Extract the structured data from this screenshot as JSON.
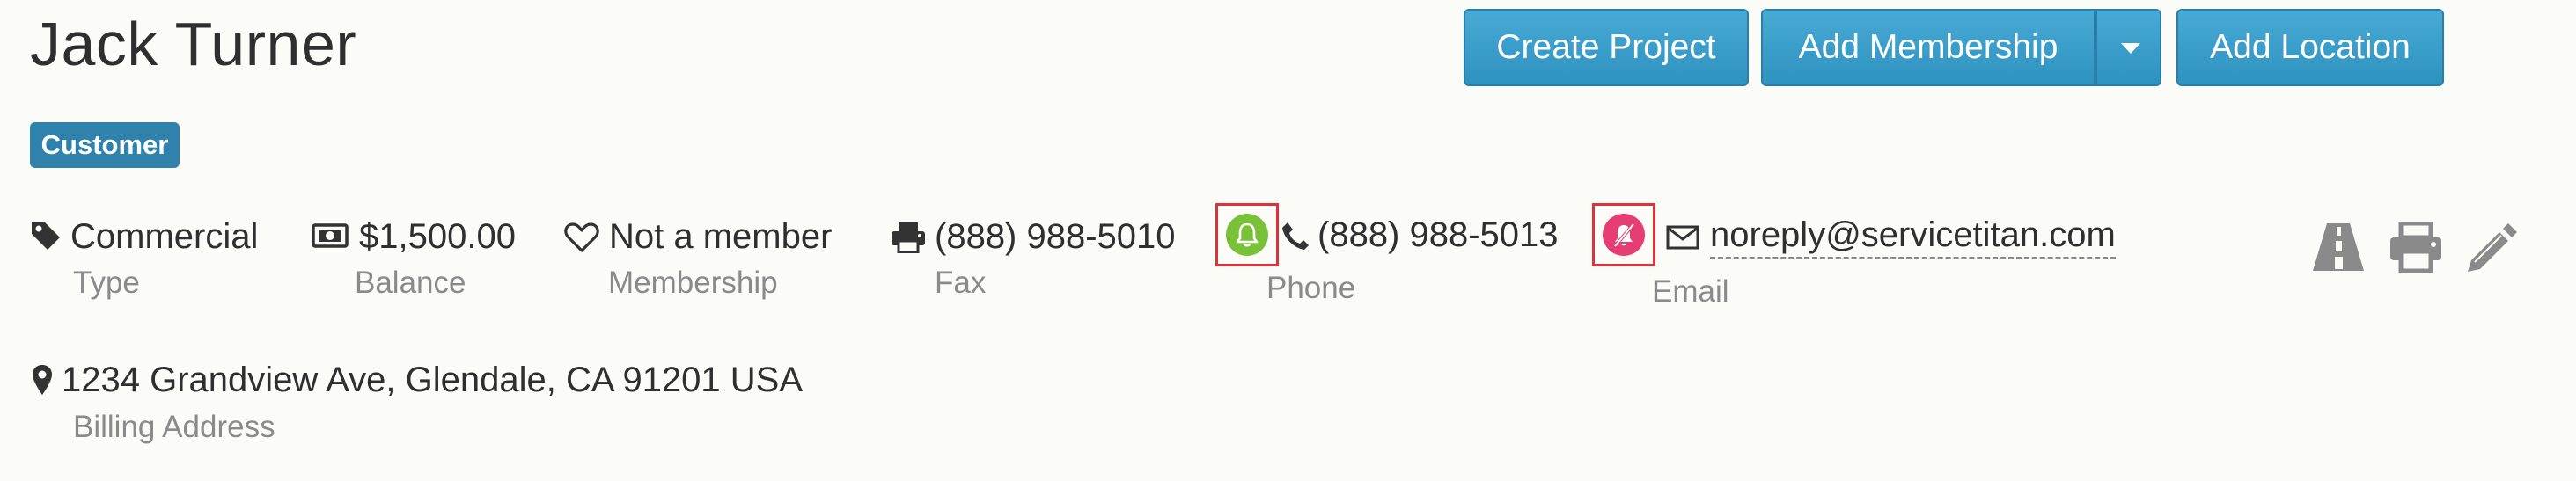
{
  "customer": {
    "name": "Jack Turner",
    "badge": "Customer"
  },
  "actions": {
    "create_project": "Create Project",
    "add_membership": "Add Membership",
    "add_location": "Add Location"
  },
  "fields": {
    "type": {
      "value": "Commercial",
      "label": "Type"
    },
    "balance": {
      "value": "$1,500.00",
      "label": "Balance"
    },
    "membership": {
      "value": "Not a member",
      "label": "Membership"
    },
    "fax": {
      "value": "(888) 988-5010",
      "label": "Fax"
    },
    "phone": {
      "value": "(888) 988-5013",
      "label": "Phone"
    },
    "email": {
      "value": "noreply@servicetitan.com",
      "label": "Email"
    },
    "billing_address": {
      "value": "1234 Grandview Ave, Glendale, CA 91201 USA",
      "label": "Billing Address"
    }
  },
  "icons": {
    "type": "tag-icon",
    "balance": "money-icon",
    "membership": "heart-icon",
    "fax": "printer-icon",
    "phone_notifications": "bell-icon",
    "phone": "phone-icon",
    "email_notifications": "bell-slash-icon",
    "email": "envelope-icon",
    "address": "map-marker-icon",
    "tools": [
      "road-icon",
      "printer-icon",
      "pencil-icon"
    ]
  },
  "colors": {
    "primary_button": "#3a9fcb",
    "badge": "#2f82ac",
    "phone_notifications_on": "#7ac13a",
    "email_notifications_off": "#e63d73",
    "highlight_border": "#d9343a"
  }
}
